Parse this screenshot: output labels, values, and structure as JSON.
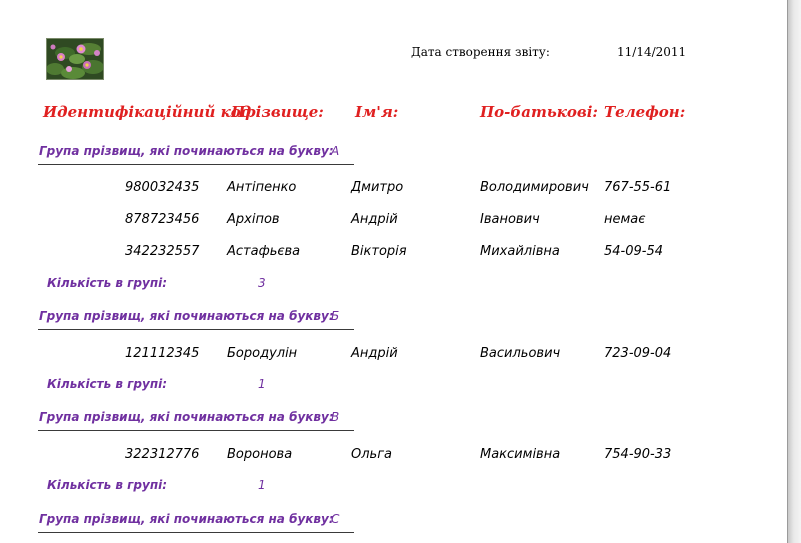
{
  "report": {
    "date_label": "Дата створення звіту:",
    "date_value": "11/14/2011",
    "headers": [
      "Идентифікаційний код",
      "Прізвище:",
      "Ім'я:",
      "По-батькові:",
      "Телефон:"
    ],
    "group_label": "Група прізвищ, які починаються на букву:",
    "count_label": "Кількість в групі:",
    "groups": [
      {
        "letter": "А",
        "rows": [
          [
            "980032435",
            "Антіпенко",
            "Дмитро",
            "Володимирович",
            "767-55-61"
          ],
          [
            "878723456",
            "Архіпов",
            "Андрій",
            "Іванович",
            "немає"
          ],
          [
            "342232557",
            "Астафьєва",
            "Вікторія",
            "Михайлівна",
            "54-09-54"
          ]
        ],
        "count": "3"
      },
      {
        "letter": "Б",
        "rows": [
          [
            "121112345",
            "Бородулін",
            "Андрій",
            "Васильович",
            "723-09-04"
          ]
        ],
        "count": "1"
      },
      {
        "letter": "В",
        "rows": [
          [
            "322312776",
            "Воронова",
            "Ольга",
            "Максимівна",
            "754-90-33"
          ]
        ],
        "count": "1"
      },
      {
        "letter": "С",
        "rows": [],
        "count": null
      }
    ]
  },
  "icons": {
    "logo": "water-lily-image"
  },
  "colors": {
    "header": "#e02020",
    "group": "#7030a0"
  }
}
